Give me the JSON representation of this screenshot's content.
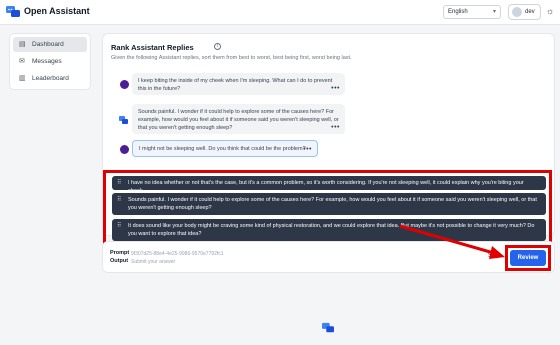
{
  "header": {
    "app_title": "Open Assistant",
    "language": "English",
    "username": "dev"
  },
  "sidebar": {
    "items": [
      {
        "label": "Dashboard",
        "icon": "dashboard-icon"
      },
      {
        "label": "Messages",
        "icon": "messages-icon"
      },
      {
        "label": "Leaderboard",
        "icon": "leaderboard-icon"
      }
    ]
  },
  "task": {
    "title": "Rank Assistant Replies",
    "description": "Given the following Assistant replies, sort them from best to worst, best being first, worst being last.",
    "conversation": [
      {
        "role": "user",
        "text": "I keep biting the inside of my cheek when I'm sleeping. What can I do to prevent this in the future?"
      },
      {
        "role": "assistant",
        "text": "Sounds painful. I wonder if it could help to explore some of the causes here? For example, how would you feel about it if someone said you weren't sleeping well, or that you weren't getting enough sleep?"
      },
      {
        "role": "user",
        "text": "I might not be sleeping well. Do you think that could be the problem?"
      }
    ],
    "replies": [
      "I have no idea whether or not that's the case, but it's a common problem, so it's worth considering. If you're not sleeping well, it could explain why you're biting your cheek.",
      "Sounds painful. I wonder if it could help to explore some of the causes here? For example, how would you feel about it if someone said you weren't sleeping well, or that you weren't getting enough sleep?",
      "It does sound like your body might be craving some kind of physical restoration, and we could explore that idea. But maybe it's not possible to change it very much? Do you want to explore that idea?"
    ]
  },
  "footer_bar": {
    "prompt_label": "Prompt",
    "prompt_value": "9f307d25-88e4-4e25-9986-9570e7792fc1",
    "output_label": "Output",
    "output_value": "Submit your answer",
    "skip_label": "Skip",
    "review_label": "Review"
  },
  "colors": {
    "accent": "#2563eb",
    "highlight": "#e00000",
    "reply_bg": "#2d3748"
  }
}
